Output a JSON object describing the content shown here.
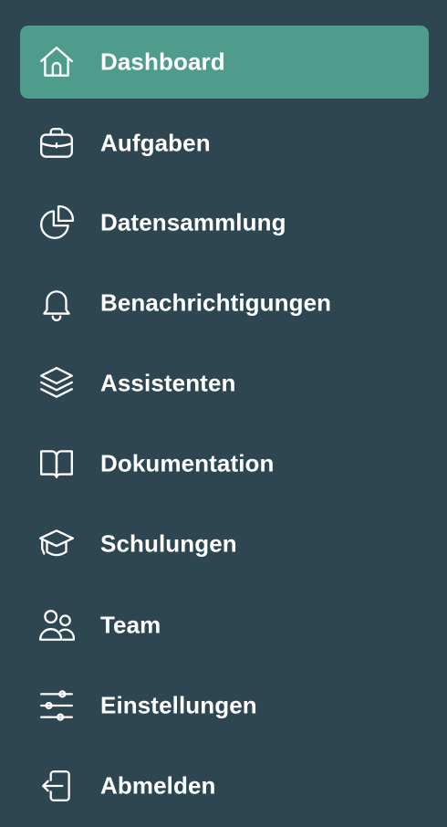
{
  "sidebar": {
    "active_color": "#4f9c8d",
    "background_color": "#2e4651",
    "items": [
      {
        "label": "Dashboard",
        "icon": "home-icon",
        "active": true
      },
      {
        "label": "Aufgaben",
        "icon": "briefcase-icon",
        "active": false
      },
      {
        "label": "Datensammlung",
        "icon": "pie-chart-icon",
        "active": false
      },
      {
        "label": "Benachrichtigungen",
        "icon": "bell-icon",
        "active": false
      },
      {
        "label": "Assistenten",
        "icon": "layers-icon",
        "active": false
      },
      {
        "label": "Dokumentation",
        "icon": "book-icon",
        "active": false
      },
      {
        "label": "Schulungen",
        "icon": "graduation-cap-icon",
        "active": false
      },
      {
        "label": "Team",
        "icon": "users-icon",
        "active": false
      },
      {
        "label": "Einstellungen",
        "icon": "sliders-icon",
        "active": false
      },
      {
        "label": "Abmelden",
        "icon": "logout-icon",
        "active": false
      }
    ]
  }
}
